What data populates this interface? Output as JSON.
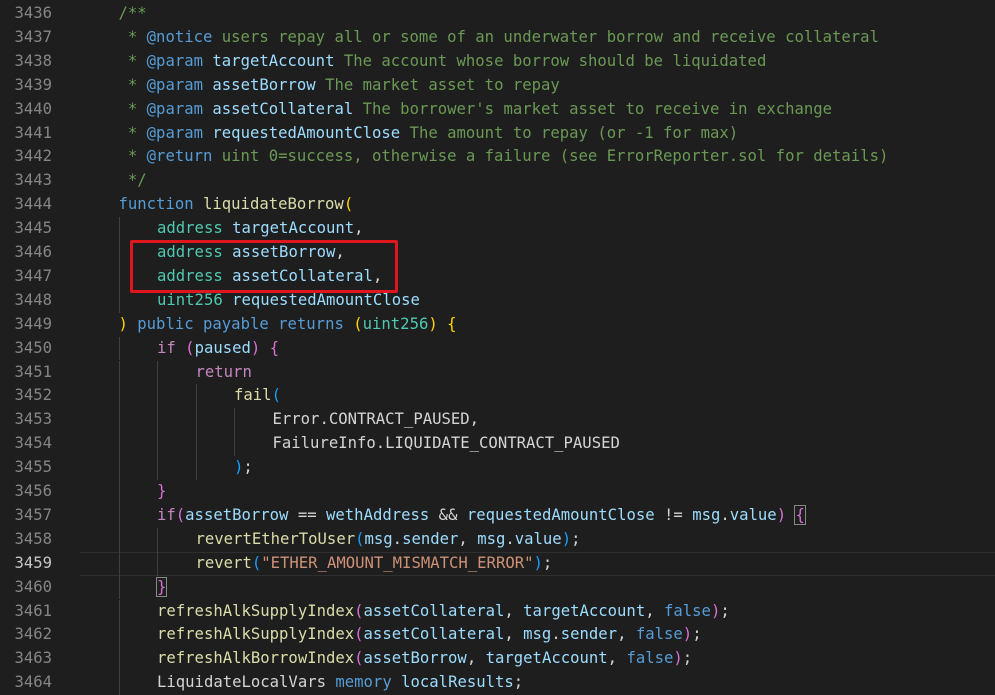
{
  "editor": {
    "current_line": "3459",
    "lines": [
      {
        "num": "3436",
        "indent": 1,
        "tokens": [
          {
            "t": "/**",
            "c": "t-c"
          }
        ]
      },
      {
        "num": "3437",
        "indent": 1,
        "tokens": [
          {
            "t": " * ",
            "c": "t-c"
          },
          {
            "t": "@notice",
            "c": "t-tag"
          },
          {
            "t": " users repay all or some of an underwater borrow and receive collateral",
            "c": "t-c"
          }
        ]
      },
      {
        "num": "3438",
        "indent": 1,
        "tokens": [
          {
            "t": " * ",
            "c": "t-c"
          },
          {
            "t": "@param",
            "c": "t-tag"
          },
          {
            "t": " ",
            "c": "t-c"
          },
          {
            "t": "targetAccount",
            "c": "t-pn"
          },
          {
            "t": " The account whose borrow should be liquidated",
            "c": "t-c"
          }
        ]
      },
      {
        "num": "3439",
        "indent": 1,
        "tokens": [
          {
            "t": " * ",
            "c": "t-c"
          },
          {
            "t": "@param",
            "c": "t-tag"
          },
          {
            "t": " ",
            "c": "t-c"
          },
          {
            "t": "assetBorrow",
            "c": "t-pn"
          },
          {
            "t": " The market asset to repay",
            "c": "t-c"
          }
        ]
      },
      {
        "num": "3440",
        "indent": 1,
        "tokens": [
          {
            "t": " * ",
            "c": "t-c"
          },
          {
            "t": "@param",
            "c": "t-tag"
          },
          {
            "t": " ",
            "c": "t-c"
          },
          {
            "t": "assetCollateral",
            "c": "t-pn"
          },
          {
            "t": " The borrower's market asset to receive in exchange",
            "c": "t-c"
          }
        ]
      },
      {
        "num": "3441",
        "indent": 1,
        "tokens": [
          {
            "t": " * ",
            "c": "t-c"
          },
          {
            "t": "@param",
            "c": "t-tag"
          },
          {
            "t": " ",
            "c": "t-c"
          },
          {
            "t": "requestedAmountClose",
            "c": "t-pn"
          },
          {
            "t": " The amount to repay (or -1 for max)",
            "c": "t-c"
          }
        ]
      },
      {
        "num": "3442",
        "indent": 1,
        "tokens": [
          {
            "t": " * ",
            "c": "t-c"
          },
          {
            "t": "@return",
            "c": "t-tag"
          },
          {
            "t": " uint 0=success, otherwise a failure (see ErrorReporter.sol for details)",
            "c": "t-c"
          }
        ]
      },
      {
        "num": "3443",
        "indent": 1,
        "tokens": [
          {
            "t": " */",
            "c": "t-c"
          }
        ]
      },
      {
        "num": "3444",
        "indent": 1,
        "tokens": [
          {
            "t": "function",
            "c": "t-kw"
          },
          {
            "t": " ",
            "c": "t-def"
          },
          {
            "t": "liquidateBorrow",
            "c": "t-fn"
          },
          {
            "t": "(",
            "c": "t-b1"
          }
        ]
      },
      {
        "num": "3445",
        "indent": 2,
        "tokens": [
          {
            "t": "address",
            "c": "t-type"
          },
          {
            "t": " ",
            "c": "t-def"
          },
          {
            "t": "targetAccount",
            "c": "t-var"
          },
          {
            "t": ",",
            "c": "t-def"
          }
        ]
      },
      {
        "num": "3446",
        "indent": 2,
        "tokens": [
          {
            "t": "address",
            "c": "t-type"
          },
          {
            "t": " ",
            "c": "t-def"
          },
          {
            "t": "assetBorrow",
            "c": "t-var"
          },
          {
            "t": ",",
            "c": "t-def"
          }
        ]
      },
      {
        "num": "3447",
        "indent": 2,
        "tokens": [
          {
            "t": "address",
            "c": "t-type"
          },
          {
            "t": " ",
            "c": "t-def"
          },
          {
            "t": "assetCollateral",
            "c": "t-var"
          },
          {
            "t": ",",
            "c": "t-def"
          }
        ]
      },
      {
        "num": "3448",
        "indent": 2,
        "tokens": [
          {
            "t": "uint256",
            "c": "t-type"
          },
          {
            "t": " ",
            "c": "t-def"
          },
          {
            "t": "requestedAmountClose",
            "c": "t-var"
          }
        ]
      },
      {
        "num": "3449",
        "indent": 1,
        "tokens": [
          {
            "t": ")",
            "c": "t-b1"
          },
          {
            "t": " ",
            "c": "t-def"
          },
          {
            "t": "public",
            "c": "t-kw"
          },
          {
            "t": " ",
            "c": "t-def"
          },
          {
            "t": "payable",
            "c": "t-kw"
          },
          {
            "t": " ",
            "c": "t-def"
          },
          {
            "t": "returns",
            "c": "t-kw"
          },
          {
            "t": " ",
            "c": "t-def"
          },
          {
            "t": "(",
            "c": "t-b1"
          },
          {
            "t": "uint256",
            "c": "t-type"
          },
          {
            "t": ")",
            "c": "t-b1"
          },
          {
            "t": " ",
            "c": "t-def"
          },
          {
            "t": "{",
            "c": "t-b1"
          }
        ]
      },
      {
        "num": "3450",
        "indent": 2,
        "tokens": [
          {
            "t": "if",
            "c": "t-ctl"
          },
          {
            "t": " ",
            "c": "t-def"
          },
          {
            "t": "(",
            "c": "t-b2"
          },
          {
            "t": "paused",
            "c": "t-var"
          },
          {
            "t": ")",
            "c": "t-b2"
          },
          {
            "t": " ",
            "c": "t-def"
          },
          {
            "t": "{",
            "c": "t-b2"
          }
        ]
      },
      {
        "num": "3451",
        "indent": 3,
        "tokens": [
          {
            "t": "return",
            "c": "t-ctl"
          }
        ]
      },
      {
        "num": "3452",
        "indent": 4,
        "tokens": [
          {
            "t": "fail",
            "c": "t-fn"
          },
          {
            "t": "(",
            "c": "t-b3"
          }
        ]
      },
      {
        "num": "3453",
        "indent": 5,
        "tokens": [
          {
            "t": "Error.CONTRACT_PAUSED,",
            "c": "t-def"
          }
        ]
      },
      {
        "num": "3454",
        "indent": 5,
        "tokens": [
          {
            "t": "FailureInfo.LIQUIDATE_CONTRACT_PAUSED",
            "c": "t-def"
          }
        ]
      },
      {
        "num": "3455",
        "indent": 4,
        "tokens": [
          {
            "t": ")",
            "c": "t-b3"
          },
          {
            "t": ";",
            "c": "t-def"
          }
        ]
      },
      {
        "num": "3456",
        "indent": 2,
        "tokens": [
          {
            "t": "}",
            "c": "t-b2"
          }
        ]
      },
      {
        "num": "3457",
        "indent": 2,
        "tokens": [
          {
            "t": "if",
            "c": "t-ctl"
          },
          {
            "t": "(",
            "c": "t-b2"
          },
          {
            "t": "assetBorrow",
            "c": "t-var"
          },
          {
            "t": " == ",
            "c": "t-def"
          },
          {
            "t": "wethAddress",
            "c": "t-var"
          },
          {
            "t": " && ",
            "c": "t-def"
          },
          {
            "t": "requestedAmountClose",
            "c": "t-var"
          },
          {
            "t": " != ",
            "c": "t-def"
          },
          {
            "t": "msg",
            "c": "t-var"
          },
          {
            "t": ".",
            "c": "t-def"
          },
          {
            "t": "value",
            "c": "t-var"
          },
          {
            "t": ")",
            "c": "t-b2"
          },
          {
            "t": " ",
            "c": "t-def"
          },
          {
            "t": "{",
            "c": "t-b2 bracket-box"
          }
        ]
      },
      {
        "num": "3458",
        "indent": 3,
        "tokens": [
          {
            "t": "revertEtherToUser",
            "c": "t-fn"
          },
          {
            "t": "(",
            "c": "t-b3"
          },
          {
            "t": "msg",
            "c": "t-var"
          },
          {
            "t": ".",
            "c": "t-def"
          },
          {
            "t": "sender",
            "c": "t-var"
          },
          {
            "t": ", ",
            "c": "t-def"
          },
          {
            "t": "msg",
            "c": "t-var"
          },
          {
            "t": ".",
            "c": "t-def"
          },
          {
            "t": "value",
            "c": "t-var"
          },
          {
            "t": ")",
            "c": "t-b3"
          },
          {
            "t": ";",
            "c": "t-def"
          }
        ]
      },
      {
        "num": "3459",
        "indent": 3,
        "tokens": [
          {
            "t": "revert",
            "c": "t-fn"
          },
          {
            "t": "(",
            "c": "t-b3"
          },
          {
            "t": "\"ETHER_AMOUNT_MISMATCH_ERROR\"",
            "c": "t-str"
          },
          {
            "t": ")",
            "c": "t-b3"
          },
          {
            "t": ";",
            "c": "t-def"
          }
        ]
      },
      {
        "num": "3460",
        "indent": 2,
        "tokens": [
          {
            "t": "}",
            "c": "t-b2 bracket-box"
          }
        ]
      },
      {
        "num": "3461",
        "indent": 2,
        "tokens": [
          {
            "t": "refreshAlkSupplyIndex",
            "c": "t-fn"
          },
          {
            "t": "(",
            "c": "t-b2"
          },
          {
            "t": "assetCollateral",
            "c": "t-var"
          },
          {
            "t": ", ",
            "c": "t-def"
          },
          {
            "t": "targetAccount",
            "c": "t-var"
          },
          {
            "t": ", ",
            "c": "t-def"
          },
          {
            "t": "false",
            "c": "t-bool"
          },
          {
            "t": ")",
            "c": "t-b2"
          },
          {
            "t": ";",
            "c": "t-def"
          }
        ]
      },
      {
        "num": "3462",
        "indent": 2,
        "tokens": [
          {
            "t": "refreshAlkSupplyIndex",
            "c": "t-fn"
          },
          {
            "t": "(",
            "c": "t-b2"
          },
          {
            "t": "assetCollateral",
            "c": "t-var"
          },
          {
            "t": ", ",
            "c": "t-def"
          },
          {
            "t": "msg",
            "c": "t-var"
          },
          {
            "t": ".",
            "c": "t-def"
          },
          {
            "t": "sender",
            "c": "t-var"
          },
          {
            "t": ", ",
            "c": "t-def"
          },
          {
            "t": "false",
            "c": "t-bool"
          },
          {
            "t": ")",
            "c": "t-b2"
          },
          {
            "t": ";",
            "c": "t-def"
          }
        ]
      },
      {
        "num": "3463",
        "indent": 2,
        "tokens": [
          {
            "t": "refreshAlkBorrowIndex",
            "c": "t-fn"
          },
          {
            "t": "(",
            "c": "t-b2"
          },
          {
            "t": "assetBorrow",
            "c": "t-var"
          },
          {
            "t": ", ",
            "c": "t-def"
          },
          {
            "t": "targetAccount",
            "c": "t-var"
          },
          {
            "t": ", ",
            "c": "t-def"
          },
          {
            "t": "false",
            "c": "t-bool"
          },
          {
            "t": ")",
            "c": "t-b2"
          },
          {
            "t": ";",
            "c": "t-def"
          }
        ]
      },
      {
        "num": "3464",
        "indent": 2,
        "tokens": [
          {
            "t": "LiquidateLocalVars",
            "c": "t-def"
          },
          {
            "t": " ",
            "c": "t-def"
          },
          {
            "t": "memory",
            "c": "t-kw"
          },
          {
            "t": " ",
            "c": "t-def"
          },
          {
            "t": "localResults",
            "c": "t-var"
          },
          {
            "t": ";",
            "c": "t-def"
          }
        ]
      }
    ]
  },
  "colors": {
    "background": "#1e1e1e",
    "line_number": "#858585",
    "highlight_box": "#e0161f"
  }
}
